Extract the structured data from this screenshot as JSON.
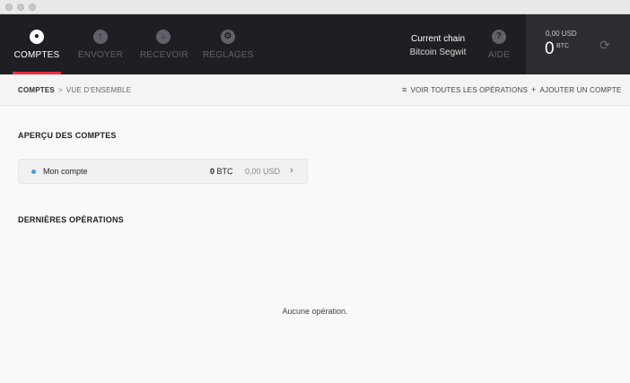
{
  "nav": {
    "comptes": "COMPTES",
    "envoyer": "ENVOYER",
    "recevoir": "RECEVOIR",
    "reglages": "RÉGLAGES",
    "aide": "AIDE"
  },
  "chain": {
    "label": "Current chain",
    "name": "Bitcoin Segwit"
  },
  "balance": {
    "usd": "0,00 USD",
    "amount": "0",
    "currency": "BTC"
  },
  "breadcrumb": {
    "root": "COMPTES",
    "separator": ">",
    "current": "VUE D'ENSEMBLE"
  },
  "actions": {
    "view_all": "VOIR TOUTES LES OPÉRATIONS",
    "add_account": "AJOUTER UN COMPTE"
  },
  "sections": {
    "overview": "APERÇU DES COMPTES",
    "recent": "DERNIÈRES OPÉRATIONS"
  },
  "accounts": [
    {
      "name": "Mon compte",
      "btc_amount": "0",
      "btc_unit": "BTC",
      "usd": "0,00 USD"
    }
  ],
  "empty_message": "Aucune opération.",
  "colors": {
    "header_bg": "#1e1f22",
    "accent_red": "#e8303f",
    "account_dot": "#3b9ede"
  }
}
